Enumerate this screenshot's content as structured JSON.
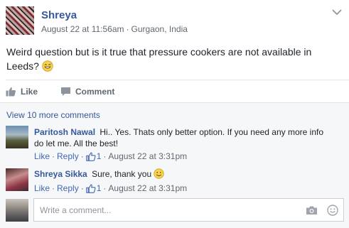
{
  "post": {
    "author": "Shreya",
    "date": "August 22 at 11:56am",
    "separator": "·",
    "location": "Gurgaon, India",
    "text": "Weird question but is it true that pressure cookers are not available in Leeds?"
  },
  "actions": {
    "like_label": "Like",
    "comment_label": "Comment"
  },
  "comments_section": {
    "view_more_label": "View 10 more comments",
    "comments": [
      {
        "author": "Paritosh Nawal",
        "text": "Hi.. Yes. Thats only better option. If you need any more info do let me. All the best!",
        "like_label": "Like",
        "reply_label": "Reply",
        "like_count": "1",
        "time": "August 22 at 3:31pm"
      },
      {
        "author": "Shreya Sikka",
        "text": "Sure, thank you",
        "like_label": "Like",
        "reply_label": "Reply",
        "like_count": "1",
        "time": "August 22 at 3:31pm"
      }
    ],
    "composer": {
      "placeholder": "Write a comment..."
    }
  },
  "colors": {
    "link": "#365899",
    "meta": "#616770",
    "background": "#f6f7f9"
  },
  "icons": [
    "chevron-down-icon",
    "sweat-smile-emoji-icon",
    "like-thumb-icon",
    "comment-bubble-icon",
    "smile-emoji-icon",
    "camera-icon",
    "emoji-picker-icon"
  ]
}
